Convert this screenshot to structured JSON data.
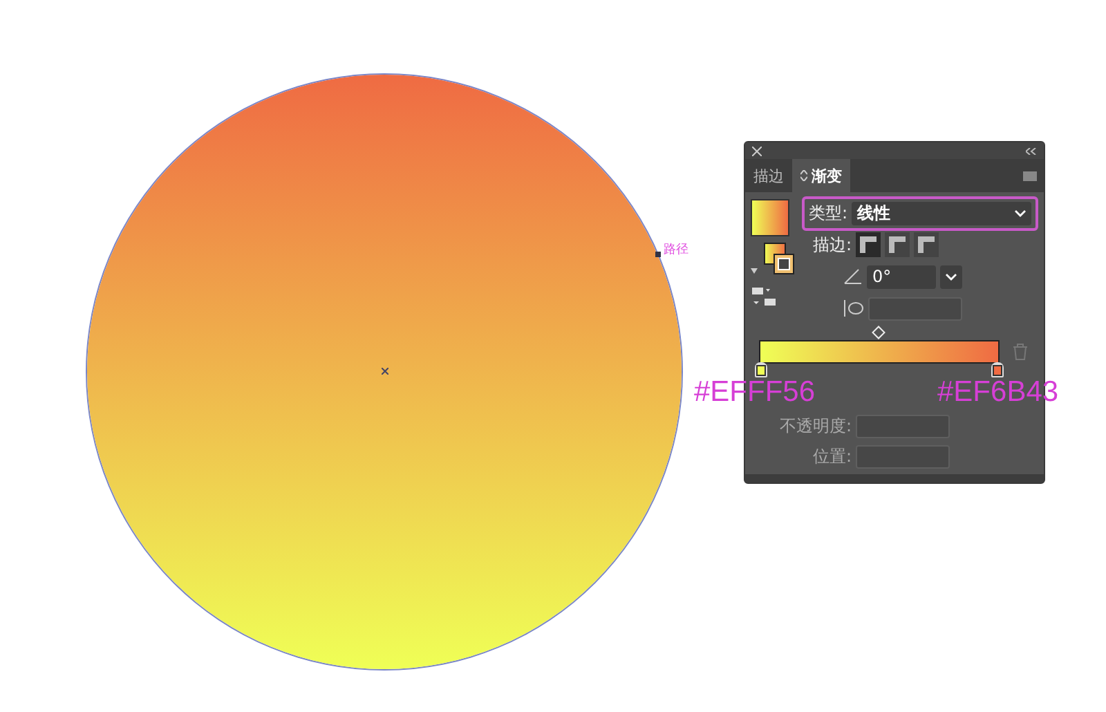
{
  "canvas": {
    "path_label": "路径",
    "annotations": [
      {
        "text": "#EFFF56",
        "color": "#d63fd6"
      },
      {
        "text": "#EF6B43",
        "color": "#d63fd6"
      }
    ]
  },
  "panel": {
    "tabs": [
      {
        "label": "描边",
        "selected": false
      },
      {
        "label": "渐变",
        "selected": true
      }
    ],
    "type_field": {
      "label": "类型:",
      "value": "线性",
      "highlighted": true
    },
    "stroke": {
      "label": "描边:",
      "options": [
        {
          "selected": true
        },
        {
          "selected": false
        },
        {
          "selected": false
        }
      ]
    },
    "angle": {
      "value": "0°"
    },
    "aspect": {
      "disabled": true
    },
    "gradient": {
      "stops": [
        {
          "color": "#efff56"
        },
        {
          "color": "#ef6b43"
        }
      ]
    },
    "opacity": {
      "label": "不透明度:",
      "disabled": true
    },
    "location": {
      "label": "位置:",
      "disabled": true
    }
  }
}
